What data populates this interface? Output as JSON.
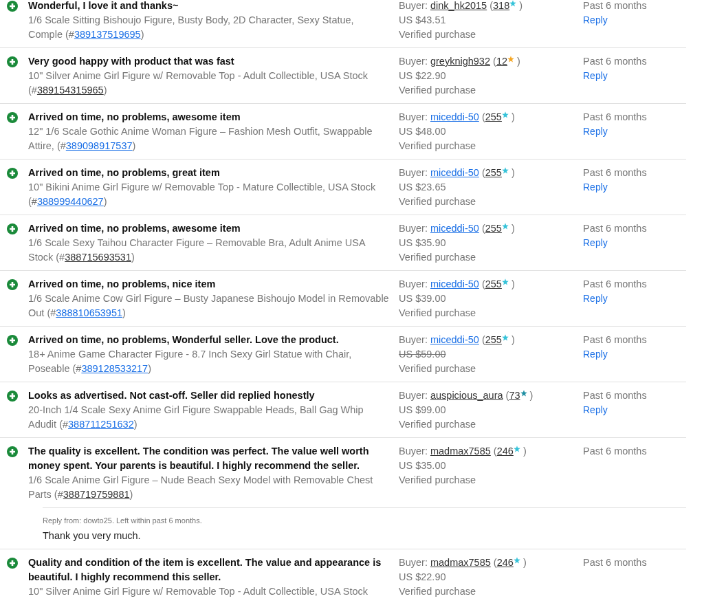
{
  "feedback": [
    {
      "kind": "positive",
      "comment": "Wonderful, I love it and thanks~",
      "item_title": "1/6 Scale Sitting Bishoujo Figure, Busty Body, 2D Character, Sexy Statue, Comple (#",
      "item_number": "389137519695",
      "item_visited": false,
      "item_close": ")",
      "buyer_label": "Buyer:",
      "buyer": "dink_hk2015",
      "buyer_visited": true,
      "score_open": "(",
      "score": "318",
      "color": "#36c3d9",
      "score_close": ")",
      "price": "US $43.51",
      "price_struck": false,
      "verified": "Verified purchase",
      "time": "Past 6 months",
      "reply_link": "Reply"
    },
    {
      "kind": "positive",
      "comment": "Very good happy with product that was fast",
      "item_title": "10\" Silver Anime Girl Figure w/ Removable Top - Adult Collectible, USA Stock (#",
      "item_number": "389154315965",
      "item_visited": true,
      "item_close": ")",
      "buyer_label": "Buyer:",
      "buyer": "greyknigh932",
      "buyer_visited": true,
      "score_open": "(",
      "score": "12",
      "color": "#f5a623",
      "score_close": ")",
      "price": "US $22.90",
      "price_struck": false,
      "verified": "Verified purchase",
      "time": "Past 6 months",
      "reply_link": "Reply"
    },
    {
      "kind": "positive",
      "comment": "Arrived on time, no problems, awesome item",
      "item_title": "12\" 1/6 Scale Gothic Anime Woman Figure – Fashion Mesh Outfit, Swappable Attire, (#",
      "item_number": "389098917537",
      "item_visited": false,
      "item_close": ")",
      "buyer_label": "Buyer:",
      "buyer": "miceddi-50",
      "buyer_visited": false,
      "score_open": "(",
      "score": "255",
      "color": "#36c3d9",
      "score_close": ")",
      "price": "US $48.00",
      "price_struck": false,
      "verified": "Verified purchase",
      "time": "Past 6 months",
      "reply_link": "Reply"
    },
    {
      "kind": "positive",
      "comment": "Arrived on time, no problems, great item",
      "item_title": "10\" Bikini Anime Girl Figure w/ Removable Top - Mature Collectible, USA Stock (#",
      "item_number": "388999440627",
      "item_visited": false,
      "item_close": ")",
      "buyer_label": "Buyer:",
      "buyer": "miceddi-50",
      "buyer_visited": false,
      "score_open": "(",
      "score": "255",
      "color": "#36c3d9",
      "score_close": ")",
      "price": "US $23.65",
      "price_struck": false,
      "verified": "Verified purchase",
      "time": "Past 6 months",
      "reply_link": "Reply"
    },
    {
      "kind": "positive",
      "comment": "Arrived on time, no problems, awesome item",
      "item_title": "1/6 Scale Sexy Taihou Character Figure – Removable Bra, Adult Anime USA Stock (#",
      "item_number": "388715693531",
      "item_visited": true,
      "item_close": ")",
      "buyer_label": "Buyer:",
      "buyer": "miceddi-50",
      "buyer_visited": false,
      "score_open": "(",
      "score": "255",
      "color": "#36c3d9",
      "score_close": ")",
      "price": "US $35.90",
      "price_struck": false,
      "verified": "Verified purchase",
      "time": "Past 6 months",
      "reply_link": "Reply"
    },
    {
      "kind": "positive",
      "comment": "Arrived on time, no problems, nice item",
      "item_title": "1/6 Scale Anime Cow Girl Figure – Busty Japanese Bishoujo Model in Removable Out (#",
      "item_number": "388810653951",
      "item_visited": false,
      "item_close": ")",
      "buyer_label": "Buyer:",
      "buyer": "miceddi-50",
      "buyer_visited": false,
      "score_open": "(",
      "score": "255",
      "color": "#36c3d9",
      "score_close": ")",
      "price": "US $39.00",
      "price_struck": false,
      "verified": "Verified purchase",
      "time": "Past 6 months",
      "reply_link": "Reply"
    },
    {
      "kind": "positive",
      "comment": "Arrived on time, no problems, Wonderful seller. Love the product.",
      "item_title": "18+ Anime Game Character Figure - 8.7 Inch Sexy Girl Statue with Chair, Poseable (#",
      "item_number": "389128533217",
      "item_visited": false,
      "item_close": ")",
      "buyer_label": "Buyer:",
      "buyer": "miceddi-50",
      "buyer_visited": false,
      "score_open": "(",
      "score": "255",
      "color": "#36c3d9",
      "score_close": ")",
      "price": "US $59.00",
      "price_struck": true,
      "verified": "Verified purchase",
      "time": "Past 6 months",
      "reply_link": "Reply"
    },
    {
      "kind": "positive",
      "comment": "Looks as advertised. Not cast-off. Seller did replied honestly",
      "item_title": "20-Inch 1/4 Scale Sexy Anime Girl Figure Swappable Heads, Ball Gag Whip Adudit (#",
      "item_number": "388711251632",
      "item_visited": false,
      "item_close": ")",
      "buyer_label": "Buyer:",
      "buyer": "auspicious_aura",
      "buyer_visited": true,
      "score_open": "(",
      "score": "73",
      "color": "#1f8fa3",
      "score_close": ")",
      "price": "US $99.00",
      "price_struck": false,
      "verified": "Verified purchase",
      "time": "Past 6 months",
      "reply_link": "Reply"
    },
    {
      "kind": "positive",
      "comment": "The quality is excellent. The condition was perfect. The value well worth money spent. Your parents is beautiful. I highly recommend the seller.",
      "item_title": "1/6 Scale Anime Girl Figure – Nude Beach Sexy Model with Removable Chest Parts (#",
      "item_number": "388719759881",
      "item_visited": true,
      "item_close": ")",
      "buyer_label": "Buyer:",
      "buyer": "madmax7585",
      "buyer_visited": true,
      "score_open": "(",
      "score": "246",
      "color": "#36c3d9",
      "score_close": ")",
      "price": "US $35.00",
      "price_struck": false,
      "verified": "Verified purchase",
      "time": "Past 6 months",
      "seller_reply": {
        "meta": "Reply from: dowto25. Left within past 6 months.",
        "text": "Thank you very much."
      }
    },
    {
      "kind": "positive",
      "comment": "Quality and condition of the item is excellent. The value and appearance is beautiful. I highly recommend this seller.",
      "item_title": "10\" Silver Anime Girl Figure w/ Removable Top - Adult Collectible, USA Stock",
      "buyer_label": "Buyer:",
      "buyer": "madmax7585",
      "buyer_visited": true,
      "score_open": "(",
      "score": "246",
      "color": "#36c3d9",
      "score_close": ")",
      "price": "US $22.90",
      "price_struck": false,
      "verified": "Verified purchase",
      "time": "Past 6 months"
    }
  ]
}
